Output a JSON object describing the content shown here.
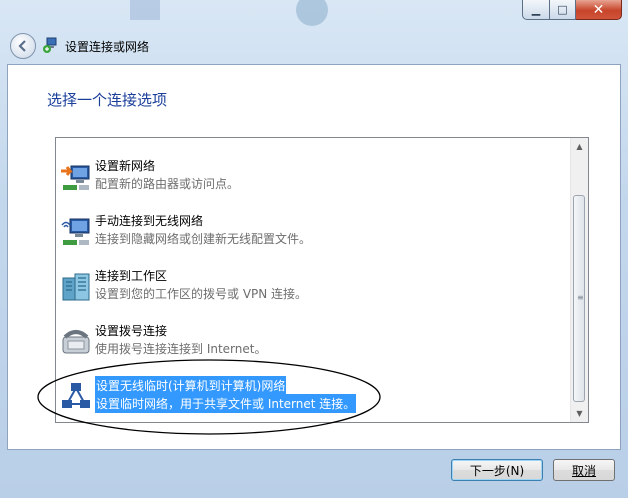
{
  "window": {
    "title": "设置连接或网络",
    "caption_buttons": {
      "minimize": "▁",
      "maximize": "□",
      "close": "✕"
    }
  },
  "heading": "选择一个连接选项",
  "options": [
    {
      "title": "设置新网络",
      "description": "配置新的路由器或访问点。",
      "icon": "router-setup-icon"
    },
    {
      "title": "手动连接到无线网络",
      "description": "连接到隐藏网络或创建新无线配置文件。",
      "icon": "wireless-manual-icon"
    },
    {
      "title": "连接到工作区",
      "description": "设置到您的工作区的拨号或 VPN 连接。",
      "icon": "workplace-icon"
    },
    {
      "title": "设置拨号连接",
      "description": "使用拨号连接连接到 Internet。",
      "icon": "dialup-icon"
    },
    {
      "title": "设置无线临时(计算机到计算机)网络",
      "description": "设置临时网络，用于共享文件或 Internet 连接。",
      "icon": "adhoc-network-icon",
      "selected": true
    }
  ],
  "buttons": {
    "next": "下一步(N)",
    "cancel": "取消"
  },
  "colors": {
    "heading": "#1a3e9a",
    "selection": "#3399ff",
    "annotation": "#000000"
  }
}
